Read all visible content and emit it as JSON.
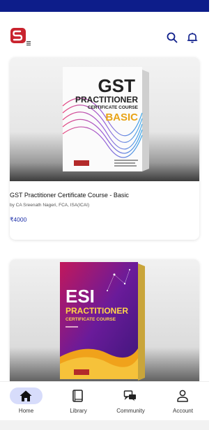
{
  "header": {
    "logo": "ssrl-logo",
    "search_icon": "search-icon",
    "bell_icon": "bell-icon",
    "menu_icon": "menu-lines-icon"
  },
  "courses": [
    {
      "title": "GST Practitioner Certificate Course - Basic",
      "author": "by CA Sreenath Nageri, FCA, ISA(ICAI)",
      "price": "₹4000",
      "box_text": {
        "line1": "GST",
        "line2": "PRACTITIONER",
        "line3": "CERTIFICATE COURSE",
        "line4": "BASIC"
      }
    },
    {
      "box_text": {
        "line1": "ESI",
        "line2": "PRACTITIONER",
        "line3": "CERTIFICATE COURSE"
      }
    }
  ],
  "nav": {
    "items": [
      {
        "label": "Home",
        "icon": "home-icon",
        "active": true
      },
      {
        "label": "Library",
        "icon": "book-icon",
        "active": false
      },
      {
        "label": "Community",
        "icon": "community-icon",
        "active": false
      },
      {
        "label": "Account",
        "icon": "person-icon",
        "active": false
      }
    ]
  },
  "colors": {
    "accent": "#0d1d8a",
    "price": "#1c2fa8",
    "nav_active_bg": "#d7dcfb",
    "logo_red": "#c9232e"
  }
}
